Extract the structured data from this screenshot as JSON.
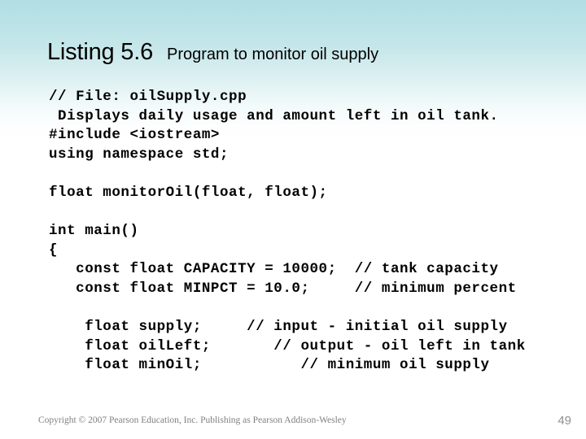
{
  "slide": {
    "background_top_color": "#b2dfe4",
    "background_bottom_color": "#ffffff"
  },
  "title": {
    "main": "Listing 5.6",
    "subtitle": "Program to monitor oil supply"
  },
  "code": {
    "language": "cpp",
    "lines": [
      "// File: oilSupply.cpp",
      " Displays daily usage and amount left in oil tank.",
      "#include <iostream>",
      "using namespace std;",
      "",
      "float monitorOil(float, float);",
      "",
      "int main()",
      "{",
      "   const float CAPACITY = 10000;  // tank capacity",
      "   const float MINPCT = 10.0;     // minimum percent",
      "",
      "    float supply;     // input - initial oil supply",
      "    float oilLeft;       // output - oil left in tank",
      "    float minOil;           // minimum oil supply"
    ]
  },
  "footer": {
    "copyright": "Copyright © 2007 Pearson Education, Inc. Publishing as Pearson Addison-Wesley",
    "page_number": "49",
    "text_color": "#808080"
  }
}
